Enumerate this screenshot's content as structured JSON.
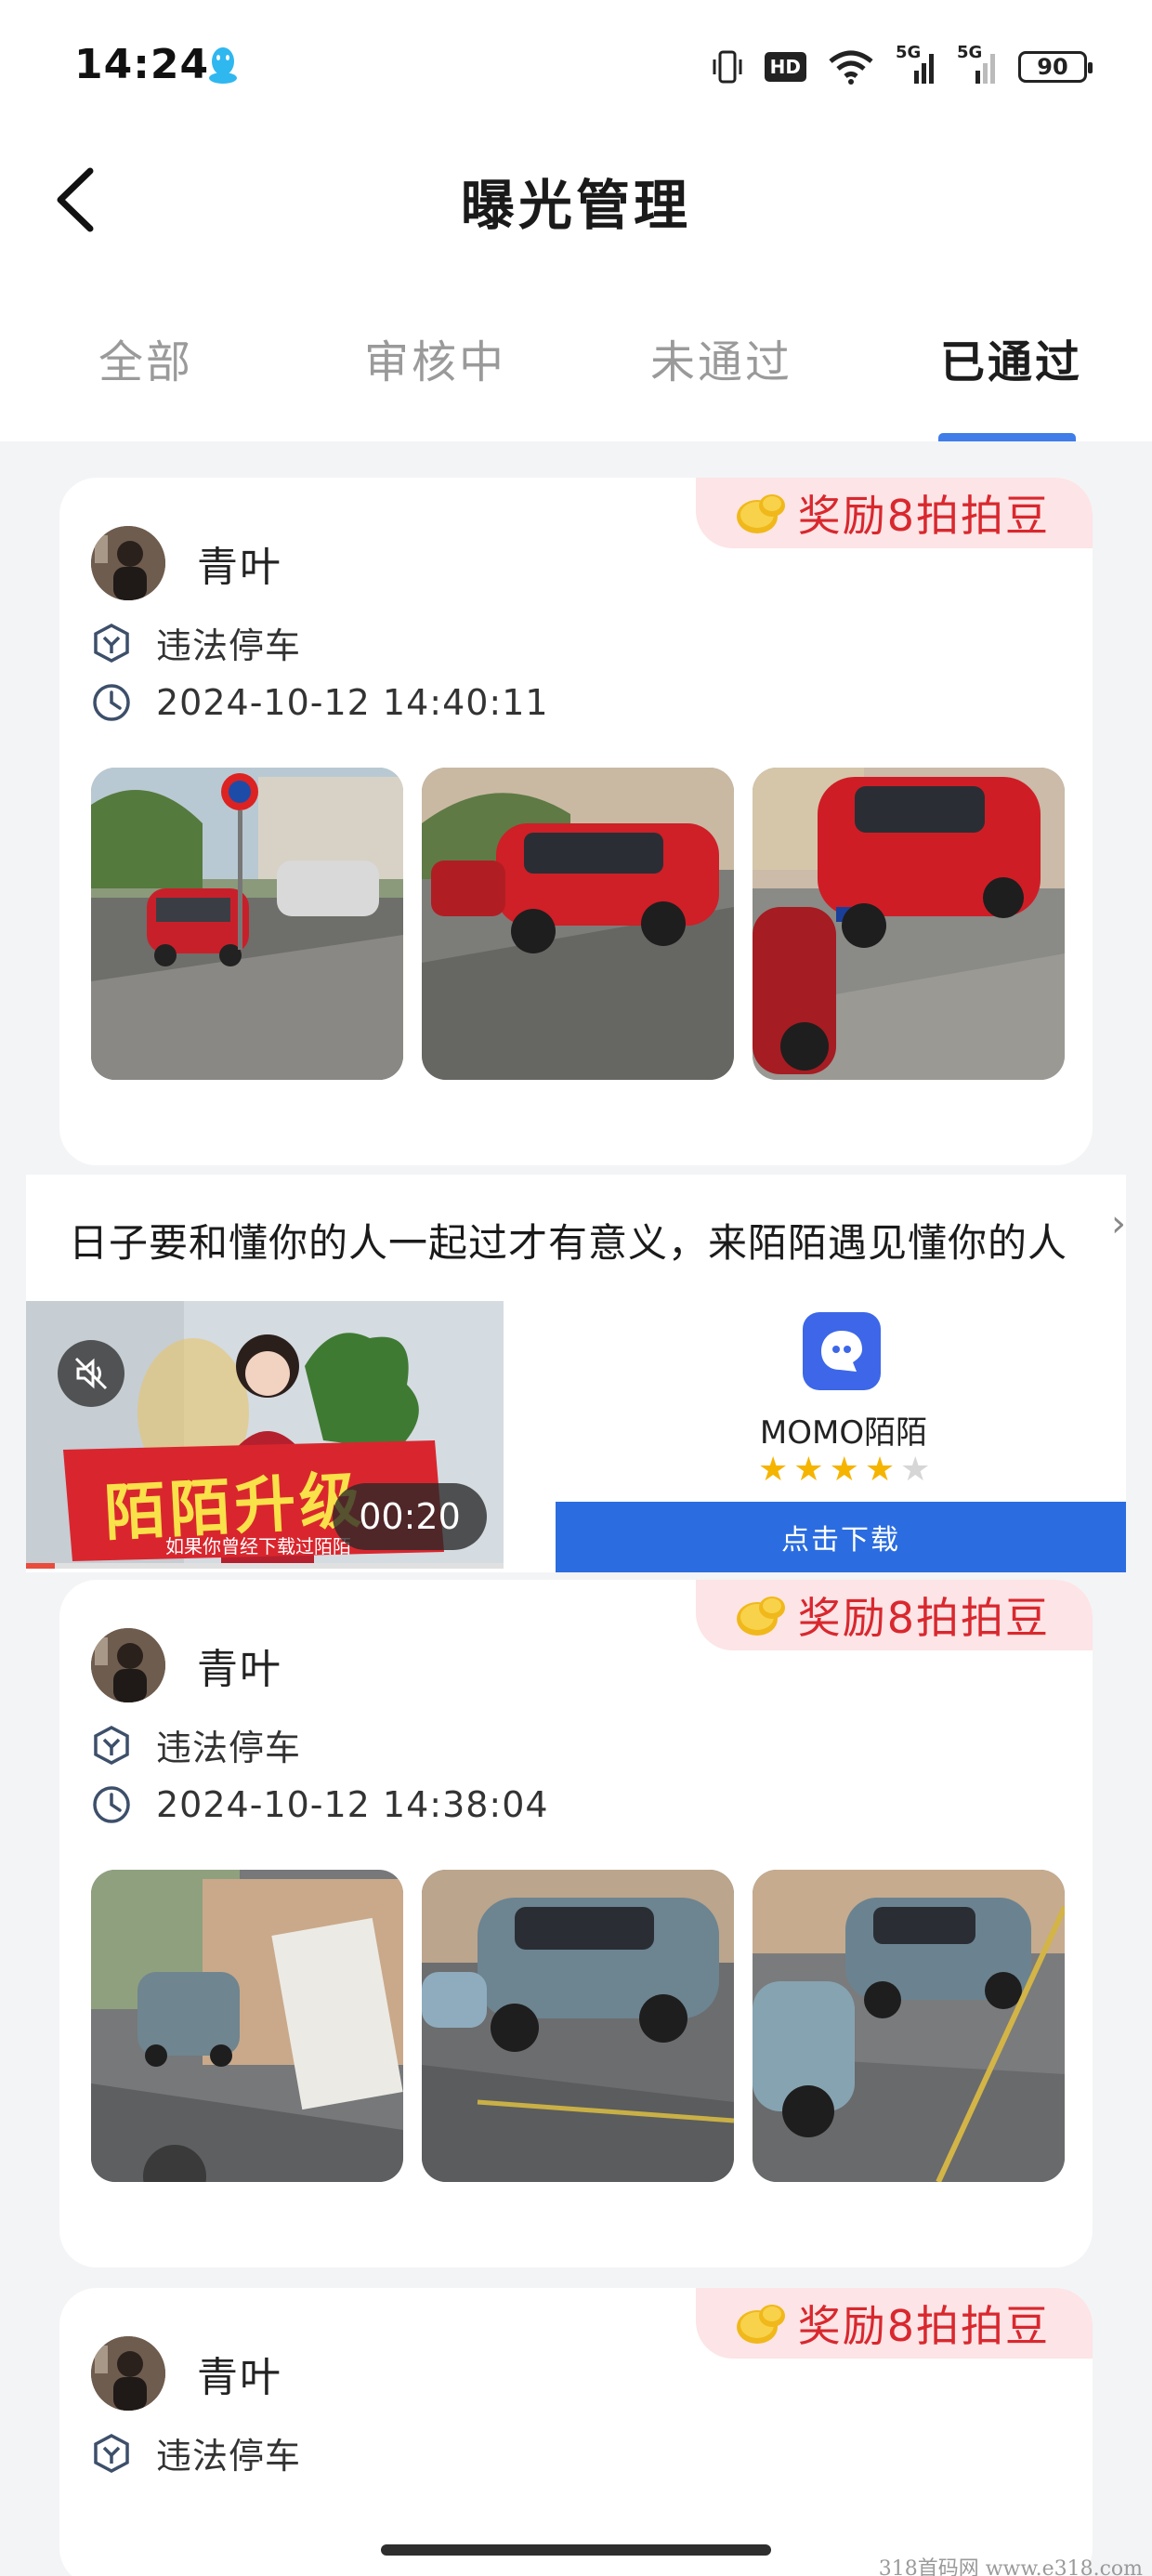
{
  "status_bar": {
    "time": "14:24",
    "network_1": "5G",
    "network_2": "5G",
    "hd_label": "HD",
    "battery": "90"
  },
  "header": {
    "back_icon": "chevron-left-icon",
    "title": "曝光管理"
  },
  "tabs": {
    "items": [
      {
        "label": "全部"
      },
      {
        "label": "审核中"
      },
      {
        "label": "未通过"
      },
      {
        "label": "已通过"
      }
    ],
    "active": "已通过"
  },
  "posts": [
    {
      "reward": "奖励8拍拍豆",
      "username": "青叶",
      "category": "违法停车",
      "datetime": "2024-10-12 14:40:11",
      "photo_count": 3
    },
    {
      "reward": "奖励8拍拍豆",
      "username": "青叶",
      "category": "违法停车",
      "datetime": "2024-10-12 14:38:04",
      "photo_count": 3
    },
    {
      "reward": "奖励8拍拍豆",
      "username": "青叶",
      "category": "违法停车"
    }
  ],
  "ad": {
    "text": "日子要和懂你的人一起过才有意义，来陌陌遇见懂你的人",
    "video_banner": "陌陌升级",
    "video_subtitle": "如果你曾经下载过陌陌",
    "video_timer": "00:20",
    "app_name": "MOMO陌陌",
    "rating": 4,
    "rating_max": 5,
    "download_label": "点击下载"
  },
  "watermark": "318首码网  www.e318.com",
  "colors": {
    "accent": "#3f7de8",
    "reward_bg": "#fde4e6",
    "reward_text": "#d8282e",
    "download": "#2b6de0"
  }
}
